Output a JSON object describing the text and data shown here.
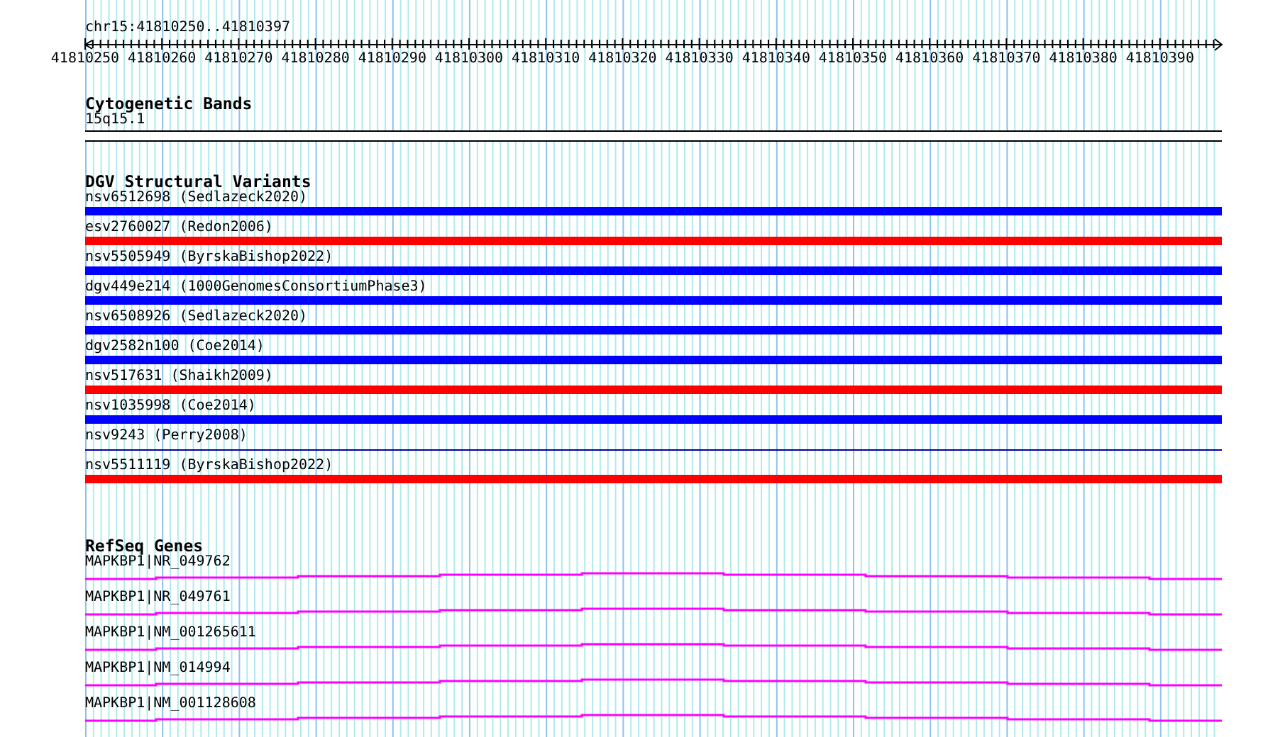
{
  "location": "chr15:41810250..41810397",
  "ruler": {
    "ticks": [
      "41810250",
      "41810260",
      "41810270",
      "41810280",
      "41810290",
      "41810300",
      "41810310",
      "41810320",
      "41810330",
      "41810340",
      "41810350",
      "41810360",
      "41810370",
      "41810380",
      "41810390"
    ]
  },
  "tracks": [
    {
      "kind": "bands",
      "title": "Cytogenetic Bands",
      "features": [
        {
          "label": "15q15.1"
        }
      ]
    },
    {
      "kind": "variants",
      "title": "DGV Structural Variants",
      "features": [
        {
          "label": "nsv6512698 (Sedlazeck2020)",
          "kind": "bar",
          "color": "#0000ff"
        },
        {
          "label": "esv2760027 (Redon2006)",
          "kind": "bar",
          "color": "#ff0000"
        },
        {
          "label": "nsv5505949 (ByrskaBishop2022)",
          "kind": "bar",
          "color": "#0000ff"
        },
        {
          "label": "dgv449e214 (1000GenomesConsortiumPhase3)",
          "kind": "bar",
          "color": "#0000ff"
        },
        {
          "label": "nsv6508926 (Sedlazeck2020)",
          "kind": "bar",
          "color": "#0000ff"
        },
        {
          "label": "dgv2582n100 (Coe2014)",
          "kind": "bar",
          "color": "#0000ff"
        },
        {
          "label": "nsv517631 (Shaikh2009)",
          "kind": "bar",
          "color": "#ff0000"
        },
        {
          "label": "nsv1035998 (Coe2014)",
          "kind": "bar",
          "color": "#0000ff"
        },
        {
          "label": "nsv9243 (Perry2008)",
          "kind": "line",
          "color": "#000099"
        },
        {
          "label": "nsv5511119 (ByrskaBishop2022)",
          "kind": "bar",
          "color": "#ff0000"
        }
      ]
    },
    {
      "kind": "genes",
      "title": "RefSeq Genes",
      "features": [
        {
          "label": "MAPKBP1|NR_049762"
        },
        {
          "label": "MAPKBP1|NR_049761"
        },
        {
          "label": "MAPKBP1|NM_001265611"
        },
        {
          "label": "MAPKBP1|NM_014994"
        },
        {
          "label": "MAPKBP1|NM_001128608"
        }
      ]
    }
  ]
}
